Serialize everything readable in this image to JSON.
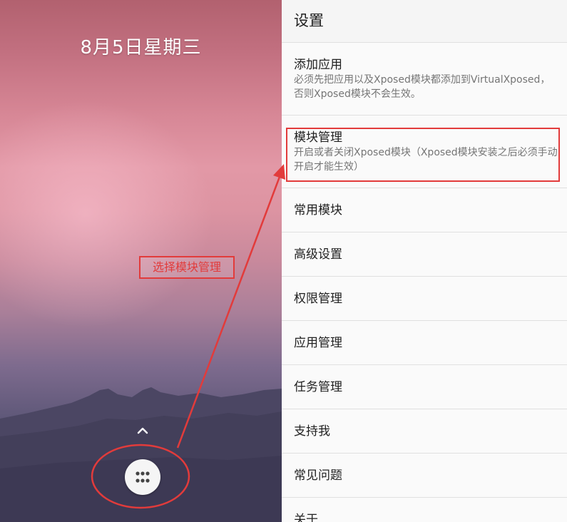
{
  "home": {
    "date": "8月5日星期三",
    "apps_icon": "apps-grid-icon",
    "swipe_icon": "chevron-up-icon"
  },
  "annotation": {
    "label": "选择模块管理",
    "color": "#e23b3b"
  },
  "settings": {
    "title": "设置",
    "items": [
      {
        "title": "添加应用",
        "summary": "必须先把应用以及Xposed模块都添加到VirtualXposed，否则Xposed模块不会生效。"
      },
      {
        "title": "模块管理",
        "summary": "开启或者关闭Xposed模块（Xposed模块安装之后必须手动开启才能生效）"
      },
      {
        "title": "常用模块"
      },
      {
        "title": "高级设置"
      },
      {
        "title": "权限管理"
      },
      {
        "title": "应用管理"
      },
      {
        "title": "任务管理"
      },
      {
        "title": "支持我"
      },
      {
        "title": "常见问题"
      },
      {
        "title": "关于"
      }
    ]
  }
}
